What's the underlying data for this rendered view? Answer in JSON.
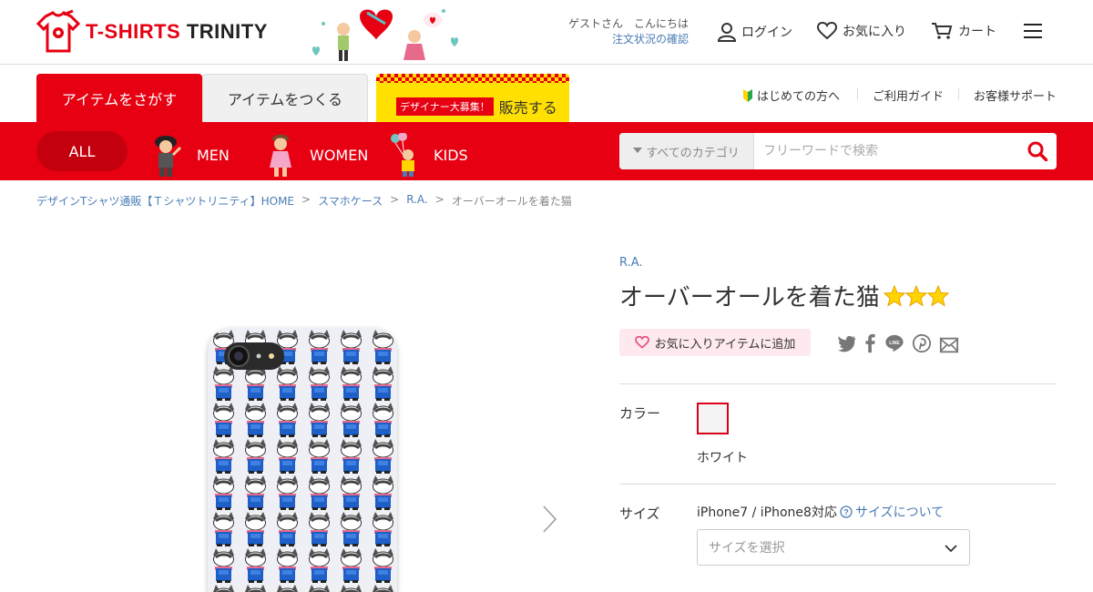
{
  "header": {
    "logo_text_1": "T-SHIRTS",
    "logo_text_2": "TRINITY",
    "guest_name": "ゲストさん",
    "greeting": "こんにちは",
    "order_status": "注文状況の確認",
    "login": "ログイン",
    "favorites": "お気に入り",
    "cart": "カート"
  },
  "tabs": {
    "search": "アイテムをさがす",
    "make": "アイテムをつくる",
    "sell_badge": "デザイナー大募集！",
    "sell": "販売する"
  },
  "sublinks": {
    "beginner": "はじめての方へ",
    "guide": "ご利用ガイド",
    "support": "お客様サポート"
  },
  "categories": {
    "all": "ALL",
    "men": "MEN",
    "women": "WOMEN",
    "kids": "KIDS"
  },
  "search": {
    "category": "すべてのカテゴリ",
    "placeholder": "フリーワードで検索"
  },
  "breadcrumb": {
    "home": "デザインTシャツ通販【Ｔシャツトリニティ】HOME",
    "cat": "スマホケース",
    "brand": "R.A.",
    "current": "オーバーオールを着た猫",
    "sep": ">"
  },
  "product": {
    "brand": "R.A.",
    "title": "オーバーオールを着た猫",
    "stars": 3,
    "fav_button": "お気に入りアイテムに追加",
    "color_label": "カラー",
    "color_name": "ホワイト",
    "size_label": "サイズ",
    "size_model": "iPhone7 / iPhone8対応",
    "size_help": "サイズについて",
    "size_placeholder": "サイズを選択"
  },
  "colors": {
    "brand_red": "#e60012",
    "link_blue": "#4a7cb5",
    "yellow": "#ffe000"
  }
}
